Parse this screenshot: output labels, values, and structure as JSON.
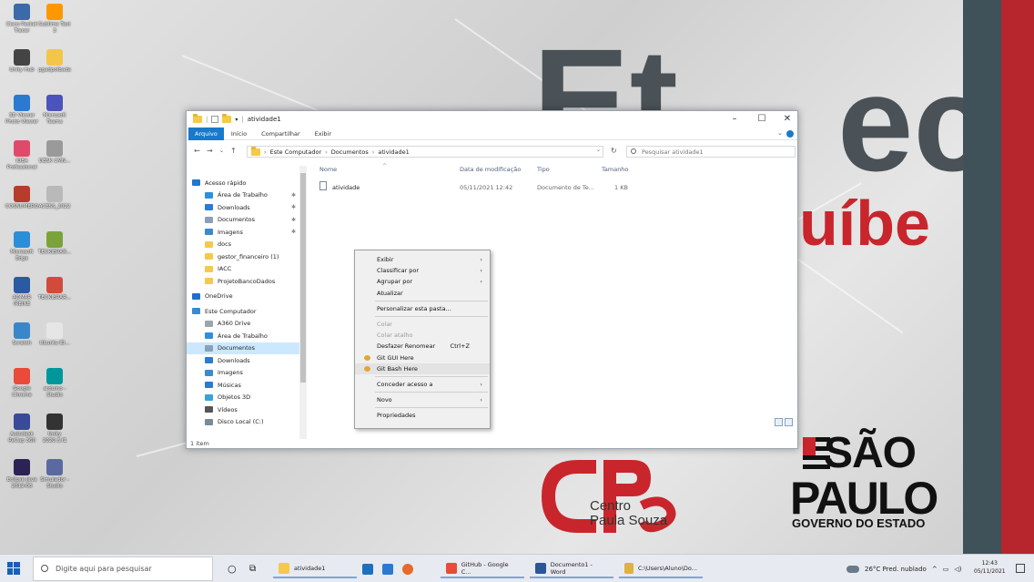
{
  "desktop": {
    "icons": [
      {
        "label": "Cisco Packet Tracer",
        "color": "#3a6aa8"
      },
      {
        "label": "Sublime Text 3",
        "color": "#ff9800"
      },
      {
        "label": "Unity Hub",
        "color": "#444444"
      },
      {
        "label": "pgadpolbada",
        "color": "#f3c64a"
      },
      {
        "label": "3D Viewer Photo Viewer",
        "color": "#2a7ad0"
      },
      {
        "label": "Microsoft Teams",
        "color": "#4b53bc"
      },
      {
        "label": "IDEA Professional",
        "color": "#e04a6a"
      },
      {
        "label": "DESK CMN...",
        "color": "#9a9a9a"
      },
      {
        "label": "COSNUMERO",
        "color": "#b63c2c"
      },
      {
        "label": "ACESS_2022",
        "color": "#b9b9b9"
      },
      {
        "label": "Microsoft Edge",
        "color": "#2a8fd8"
      },
      {
        "label": "TECKIBRAR...",
        "color": "#7aa33a"
      },
      {
        "label": "ADMAR IREINE",
        "color": "#2a5aa0"
      },
      {
        "label": "TECKIBRAR...",
        "color": "#d24a3a"
      },
      {
        "label": "Scratch",
        "color": "#3a86c8"
      },
      {
        "label": "Ubuntu ID...",
        "color": "#e6e6e6"
      },
      {
        "label": "Google Chrome",
        "color": "#e94a3a"
      },
      {
        "label": "arduino - Studio",
        "color": "#00979c"
      },
      {
        "label": "Autodesk ReCap 360",
        "color": "#3a4a9a"
      },
      {
        "label": "Unity 2020.3.f1",
        "color": "#333333"
      },
      {
        "label": "Eclipse Java 2019-06",
        "color": "#2c2255"
      },
      {
        "label": "Simulador - Studio",
        "color": "#5a6aa0"
      }
    ]
  },
  "wallpaper": {
    "etec_e": "Et",
    "etec_c": "ec",
    "ibe": "uíbe",
    "cps_line1": "Centro",
    "cps_line2": "Paula Souza",
    "sp_sao": "SÃO",
    "sp_paulo": "PAULO",
    "sp_gov": "GOVERNO DO ESTADO"
  },
  "explorer": {
    "title": "atividade1",
    "ribbon_tabs": [
      "Arquivo",
      "Início",
      "Compartilhar",
      "Exibir"
    ],
    "breadcrumb": [
      "Este Computador",
      "Documentos",
      "atividade1"
    ],
    "search_placeholder": "Pesquisar atividade1",
    "nav_items": [
      {
        "label": "Acesso rápido",
        "color": "#1f78d1",
        "pin": false,
        "indent": 0
      },
      {
        "label": "Área de Trabalho",
        "color": "#2f8fdf",
        "pin": true,
        "indent": 1
      },
      {
        "label": "Downloads",
        "color": "#2a7bd4",
        "pin": true,
        "indent": 1
      },
      {
        "label": "Documentos",
        "color": "#8aa0b8",
        "pin": true,
        "indent": 1
      },
      {
        "label": "Imagens",
        "color": "#3a8ad0",
        "pin": true,
        "indent": 1
      },
      {
        "label": "docs",
        "color": "#f5c94c",
        "pin": false,
        "indent": 1
      },
      {
        "label": "gestor_financeiro (1)",
        "color": "#f5c94c",
        "pin": false,
        "indent": 1
      },
      {
        "label": "IACC",
        "color": "#f5c94c",
        "pin": false,
        "indent": 1
      },
      {
        "label": "ProjetoBancoDados",
        "color": "#f5c94c",
        "pin": false,
        "indent": 1
      },
      {
        "label": "OneDrive",
        "color": "#1f6fc8",
        "pin": false,
        "indent": 0
      },
      {
        "label": "Este Computador",
        "color": "#3a8ad0",
        "pin": false,
        "indent": 0
      },
      {
        "label": "A360 Drive",
        "color": "#9aa5b0",
        "pin": false,
        "indent": 1
      },
      {
        "label": "Área de Trabalho",
        "color": "#2f8fdf",
        "pin": false,
        "indent": 1
      },
      {
        "label": "Documentos",
        "color": "#8aa0b8",
        "pin": false,
        "indent": 1,
        "selected": true
      },
      {
        "label": "Downloads",
        "color": "#2a7bd4",
        "pin": false,
        "indent": 1
      },
      {
        "label": "Imagens",
        "color": "#3a8ad0",
        "pin": false,
        "indent": 1
      },
      {
        "label": "Músicas",
        "color": "#2a7bd4",
        "pin": false,
        "indent": 1
      },
      {
        "label": "Objetos 3D",
        "color": "#3aa0d8",
        "pin": false,
        "indent": 1
      },
      {
        "label": "Vídeos",
        "color": "#555555",
        "pin": false,
        "indent": 1
      },
      {
        "label": "Disco Local (C:)",
        "color": "#7a8a9a",
        "pin": false,
        "indent": 1
      }
    ],
    "columns": [
      "Nome",
      "Data de modificação",
      "Tipo",
      "Tamanho"
    ],
    "files": [
      {
        "name": "atividade",
        "modified": "05/11/2021 12:42",
        "type": "Documento de Te...",
        "size": "1 KB"
      }
    ],
    "status": "1 item"
  },
  "context_menu": {
    "items": [
      {
        "label": "Exibir",
        "arrow": true
      },
      {
        "label": "Classificar por",
        "arrow": true
      },
      {
        "label": "Agrupar por",
        "arrow": true
      },
      {
        "label": "Atualizar"
      },
      {
        "sep": true
      },
      {
        "label": "Personalizar esta pasta..."
      },
      {
        "sep": true
      },
      {
        "label": "Colar",
        "disabled": true
      },
      {
        "label": "Colar atalho",
        "disabled": true
      },
      {
        "label": "Desfazer Renomear",
        "shortcut": "Ctrl+Z"
      },
      {
        "label": "Git GUI Here",
        "git": true
      },
      {
        "label": "Git Bash Here",
        "git": true,
        "highlight": true
      },
      {
        "sep": true
      },
      {
        "label": "Conceder acesso a",
        "arrow": true
      },
      {
        "sep": true
      },
      {
        "label": "Novo",
        "arrow": true
      },
      {
        "sep": true
      },
      {
        "label": "Propriedades"
      }
    ]
  },
  "taskbar": {
    "search_placeholder": "Digite aqui para pesquisar",
    "apps": [
      {
        "label": "atividade1",
        "color": "#f5c94c"
      },
      {
        "label": "GitHub - Google C...",
        "color": "#e94a3a"
      },
      {
        "label": "Documento1 - Word",
        "color": "#2b579a"
      },
      {
        "label": "C:\\Users\\Aluno\\Do...",
        "color": "#e0b040"
      }
    ],
    "weather": "26°C  Pred. nublado",
    "time": "12:43",
    "date": "05/11/2021"
  }
}
